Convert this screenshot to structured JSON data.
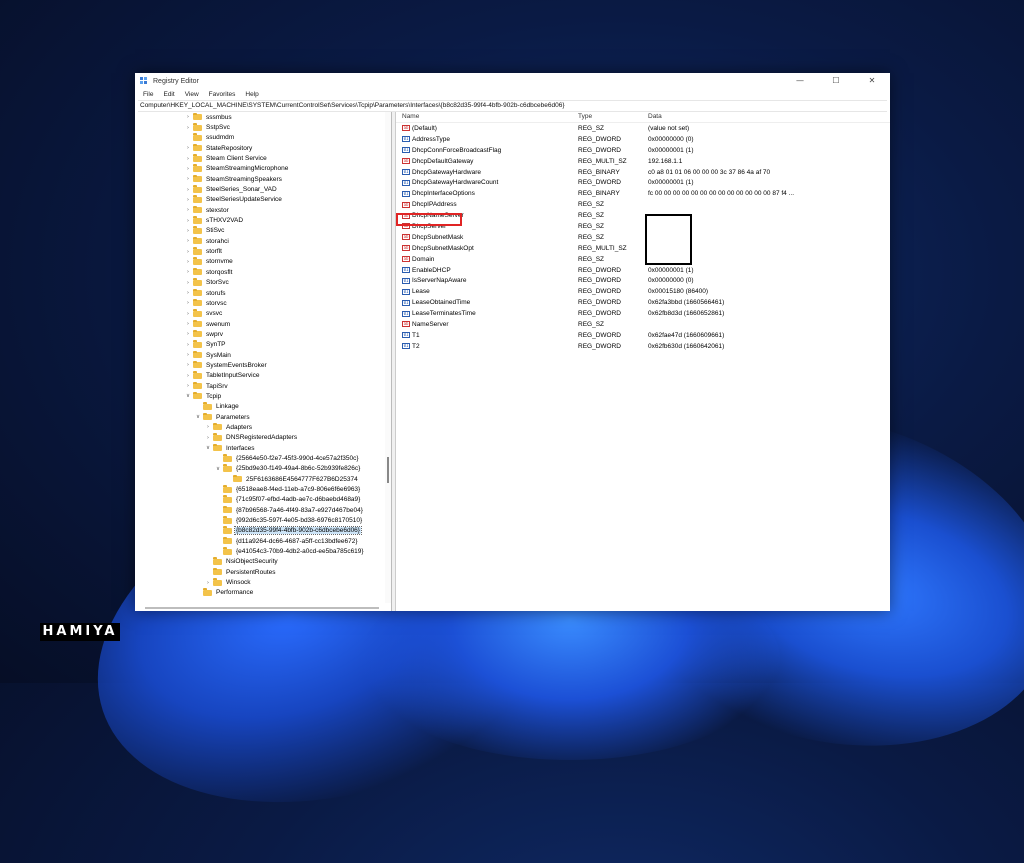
{
  "window": {
    "title": "Registry Editor",
    "controls": {
      "minimize": "—",
      "maximize": "☐",
      "close": "✕"
    }
  },
  "menu": [
    "File",
    "Edit",
    "View",
    "Favorites",
    "Help"
  ],
  "address": "Computer\\HKEY_LOCAL_MACHINE\\SYSTEM\\CurrentControlSet\\Services\\Tcpip\\Parameters\\Interfaces\\{b8c82d35-99f4-4bfb-902b-c6dbcebe6d06}",
  "tree": [
    {
      "label": "sssmbus",
      "depth": 0,
      "exp": "collapsed"
    },
    {
      "label": "SstpSvc",
      "depth": 0,
      "exp": "collapsed"
    },
    {
      "label": "ssudmdm",
      "depth": 0,
      "exp": "none"
    },
    {
      "label": "StateRepository",
      "depth": 0,
      "exp": "collapsed"
    },
    {
      "label": "Steam Client Service",
      "depth": 0,
      "exp": "collapsed"
    },
    {
      "label": "SteamStreamingMicrophone",
      "depth": 0,
      "exp": "collapsed"
    },
    {
      "label": "SteamStreamingSpeakers",
      "depth": 0,
      "exp": "collapsed"
    },
    {
      "label": "SteelSeries_Sonar_VAD",
      "depth": 0,
      "exp": "collapsed"
    },
    {
      "label": "SteelSeriesUpdateService",
      "depth": 0,
      "exp": "collapsed"
    },
    {
      "label": "stexstor",
      "depth": 0,
      "exp": "collapsed"
    },
    {
      "label": "sTHXV2VAD",
      "depth": 0,
      "exp": "collapsed"
    },
    {
      "label": "StiSvc",
      "depth": 0,
      "exp": "collapsed"
    },
    {
      "label": "storahci",
      "depth": 0,
      "exp": "collapsed"
    },
    {
      "label": "storflt",
      "depth": 0,
      "exp": "collapsed"
    },
    {
      "label": "stornvme",
      "depth": 0,
      "exp": "collapsed"
    },
    {
      "label": "storqosflt",
      "depth": 0,
      "exp": "collapsed"
    },
    {
      "label": "StorSvc",
      "depth": 0,
      "exp": "collapsed"
    },
    {
      "label": "storufs",
      "depth": 0,
      "exp": "collapsed"
    },
    {
      "label": "storvsc",
      "depth": 0,
      "exp": "collapsed"
    },
    {
      "label": "svsvc",
      "depth": 0,
      "exp": "collapsed"
    },
    {
      "label": "swenum",
      "depth": 0,
      "exp": "collapsed"
    },
    {
      "label": "swprv",
      "depth": 0,
      "exp": "collapsed"
    },
    {
      "label": "SynTP",
      "depth": 0,
      "exp": "collapsed"
    },
    {
      "label": "SysMain",
      "depth": 0,
      "exp": "collapsed"
    },
    {
      "label": "SystemEventsBroker",
      "depth": 0,
      "exp": "collapsed"
    },
    {
      "label": "TabletInputService",
      "depth": 0,
      "exp": "collapsed"
    },
    {
      "label": "TapiSrv",
      "depth": 0,
      "exp": "collapsed"
    },
    {
      "label": "Tcpip",
      "depth": 0,
      "exp": "expanded"
    },
    {
      "label": "Linkage",
      "depth": 1,
      "exp": "none"
    },
    {
      "label": "Parameters",
      "depth": 1,
      "exp": "expanded"
    },
    {
      "label": "Adapters",
      "depth": 2,
      "exp": "collapsed"
    },
    {
      "label": "DNSRegisteredAdapters",
      "depth": 2,
      "exp": "collapsed"
    },
    {
      "label": "Interfaces",
      "depth": 2,
      "exp": "expanded"
    },
    {
      "label": "{25664e50-f2e7-45f3-990d-4ce57a2f350c}",
      "depth": 3,
      "exp": "none"
    },
    {
      "label": "{25bd9e30-f149-49a4-8b6c-52b939fe826c}",
      "depth": 3,
      "exp": "expanded"
    },
    {
      "label": "25F6163686E4564777F627B6D25374",
      "depth": 4,
      "exp": "none"
    },
    {
      "label": "{6518eae8-f4ed-11eb-a7c9-806e6f6e6963}",
      "depth": 3,
      "exp": "none"
    },
    {
      "label": "{71c95f07-efbd-4adb-ae7c-d6baebd468a9}",
      "depth": 3,
      "exp": "none"
    },
    {
      "label": "{87b96568-7a46-4f49-83a7-e927d467be04}",
      "depth": 3,
      "exp": "none"
    },
    {
      "label": "{992d6c35-597f-4e05-bd38-6976c8170510}",
      "depth": 3,
      "exp": "none"
    },
    {
      "label": "{b8c82d35-99f4-4bfb-902b-c6dbcebe6d06}",
      "depth": 3,
      "exp": "none",
      "selected": true
    },
    {
      "label": "{d11a9264-dc66-4687-a5ff-cc13bdfee672}",
      "depth": 3,
      "exp": "none"
    },
    {
      "label": "{e41054c3-70b9-4db2-a0cd-ee5ba785c619}",
      "depth": 3,
      "exp": "none"
    },
    {
      "label": "NsiObjectSecurity",
      "depth": 2,
      "exp": "none"
    },
    {
      "label": "PersistentRoutes",
      "depth": 2,
      "exp": "none"
    },
    {
      "label": "Winsock",
      "depth": 2,
      "exp": "collapsed"
    },
    {
      "label": "Performance",
      "depth": 1,
      "exp": "none"
    }
  ],
  "columns": {
    "name": "Name",
    "type": "Type",
    "data": "Data"
  },
  "values": [
    {
      "name": "(Default)",
      "type": "REG_SZ",
      "data": "(value not set)",
      "icon": "sz"
    },
    {
      "name": "AddressType",
      "type": "REG_DWORD",
      "data": "0x00000000 (0)",
      "icon": "bin"
    },
    {
      "name": "DhcpConnForceBroadcastFlag",
      "type": "REG_DWORD",
      "data": "0x00000001 (1)",
      "icon": "bin"
    },
    {
      "name": "DhcpDefaultGateway",
      "type": "REG_MULTI_SZ",
      "data": "192.168.1.1",
      "icon": "sz"
    },
    {
      "name": "DhcpGatewayHardware",
      "type": "REG_BINARY",
      "data": "c0 a8 01 01 06 00 00 00 3c 37 86 4a af 70",
      "icon": "bin"
    },
    {
      "name": "DhcpGatewayHardwareCount",
      "type": "REG_DWORD",
      "data": "0x00000001 (1)",
      "icon": "bin"
    },
    {
      "name": "DhcpInterfaceOptions",
      "type": "REG_BINARY",
      "data": "fc 00 00 00 00 00 00 00 00 00 00 00 00 00 87 f4 ...",
      "icon": "bin"
    },
    {
      "name": "DhcpIPAddress",
      "type": "REG_SZ",
      "data": "",
      "icon": "sz"
    },
    {
      "name": "DhcpNameServer",
      "type": "REG_SZ",
      "data": "",
      "icon": "sz"
    },
    {
      "name": "DhcpServer",
      "type": "REG_SZ",
      "data": "",
      "icon": "sz"
    },
    {
      "name": "DhcpSubnetMask",
      "type": "REG_SZ",
      "data": "",
      "icon": "sz"
    },
    {
      "name": "DhcpSubnetMaskOpt",
      "type": "REG_MULTI_SZ",
      "data": "",
      "icon": "sz"
    },
    {
      "name": "Domain",
      "type": "REG_SZ",
      "data": "",
      "icon": "sz"
    },
    {
      "name": "EnableDHCP",
      "type": "REG_DWORD",
      "data": "0x00000001 (1)",
      "icon": "bin"
    },
    {
      "name": "IsServerNapAware",
      "type": "REG_DWORD",
      "data": "0x00000000 (0)",
      "icon": "bin"
    },
    {
      "name": "Lease",
      "type": "REG_DWORD",
      "data": "0x00015180 (86400)",
      "icon": "bin"
    },
    {
      "name": "LeaseObtainedTime",
      "type": "REG_DWORD",
      "data": "0x62fa3bbd (1660566461)",
      "icon": "bin"
    },
    {
      "name": "LeaseTerminatesTime",
      "type": "REG_DWORD",
      "data": "0x62fb8d3d (1660652861)",
      "icon": "bin"
    },
    {
      "name": "NameServer",
      "type": "REG_SZ",
      "data": "",
      "icon": "sz"
    },
    {
      "name": "T1",
      "type": "REG_DWORD",
      "data": "0x62fae47d (1660609661)",
      "icon": "bin"
    },
    {
      "name": "T2",
      "type": "REG_DWORD",
      "data": "0x62fb630d (1660642061)",
      "icon": "bin"
    }
  ],
  "icon_glyphs": {
    "sz": "ab",
    "bin": "01"
  },
  "watermark": "HAMIYA",
  "colors": {
    "highlight": "#e02424",
    "selection": "#cce4f7",
    "folder": "#f3c34a"
  }
}
